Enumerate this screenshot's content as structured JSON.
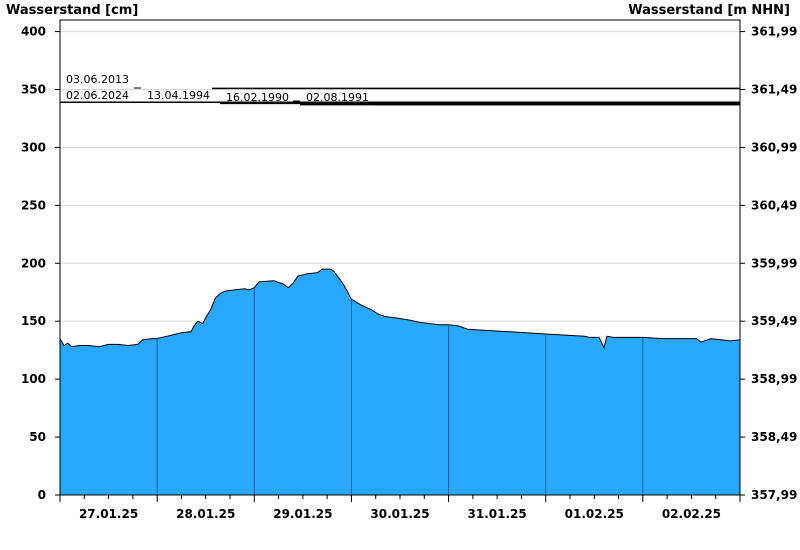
{
  "chart_data": {
    "type": "area",
    "y_left_label": "Wasserstand [cm]",
    "y_right_label": "Wasserstand [m NHN]",
    "ylim": [
      0,
      410
    ],
    "y_ticks": [
      0,
      50,
      100,
      150,
      200,
      250,
      300,
      350,
      400
    ],
    "y_right_ticks": [
      "357,99",
      "358,49",
      "358,99",
      "359,49",
      "359,99",
      "360,49",
      "360,99",
      "361,49",
      "361,99"
    ],
    "x_labels": [
      "27.01.25",
      "28.01.25",
      "29.01.25",
      "30.01.25",
      "31.01.25",
      "01.02.25",
      "02.02.25"
    ],
    "x_range_days": [
      0,
      7
    ],
    "grid": true,
    "fill_color": "#29a8ff",
    "series": [
      {
        "values": [
          [
            0.0,
            135
          ],
          [
            0.04,
            129
          ],
          [
            0.08,
            131
          ],
          [
            0.12,
            128
          ],
          [
            0.2,
            129
          ],
          [
            0.3,
            129
          ],
          [
            0.4,
            128
          ],
          [
            0.5,
            130
          ],
          [
            0.6,
            130
          ],
          [
            0.7,
            129
          ],
          [
            0.8,
            130
          ],
          [
            0.85,
            134
          ],
          [
            0.95,
            135
          ],
          [
            1.0,
            135
          ],
          [
            1.05,
            136
          ],
          [
            1.1,
            137
          ],
          [
            1.15,
            138
          ],
          [
            1.25,
            140
          ],
          [
            1.35,
            141
          ],
          [
            1.38,
            146
          ],
          [
            1.42,
            150
          ],
          [
            1.47,
            148
          ],
          [
            1.5,
            153
          ],
          [
            1.55,
            160
          ],
          [
            1.6,
            170
          ],
          [
            1.65,
            174
          ],
          [
            1.7,
            176
          ],
          [
            1.8,
            177
          ],
          [
            1.9,
            178
          ],
          [
            1.95,
            177
          ],
          [
            2.0,
            179
          ],
          [
            2.05,
            184
          ],
          [
            2.2,
            185
          ],
          [
            2.3,
            182
          ],
          [
            2.35,
            179
          ],
          [
            2.4,
            183
          ],
          [
            2.45,
            189
          ],
          [
            2.55,
            191
          ],
          [
            2.65,
            192
          ],
          [
            2.7,
            195
          ],
          [
            2.78,
            195
          ],
          [
            2.82,
            193
          ],
          [
            2.9,
            184
          ],
          [
            2.95,
            177
          ],
          [
            3.0,
            169
          ],
          [
            3.1,
            164
          ],
          [
            3.2,
            160
          ],
          [
            3.28,
            156
          ],
          [
            3.35,
            154
          ],
          [
            3.45,
            153
          ],
          [
            3.6,
            151
          ],
          [
            3.7,
            149
          ],
          [
            3.8,
            148
          ],
          [
            3.9,
            147
          ],
          [
            4.0,
            147
          ],
          [
            4.1,
            146
          ],
          [
            4.2,
            143
          ],
          [
            4.4,
            142
          ],
          [
            4.6,
            141
          ],
          [
            4.8,
            140
          ],
          [
            5.0,
            139
          ],
          [
            5.2,
            138
          ],
          [
            5.4,
            137
          ],
          [
            5.45,
            136
          ],
          [
            5.55,
            136
          ],
          [
            5.6,
            127
          ],
          [
            5.63,
            137
          ],
          [
            5.7,
            136
          ],
          [
            5.8,
            136
          ],
          [
            6.0,
            136
          ],
          [
            6.2,
            135
          ],
          [
            6.4,
            135
          ],
          [
            6.55,
            135
          ],
          [
            6.6,
            132
          ],
          [
            6.7,
            135
          ],
          [
            6.8,
            134
          ],
          [
            6.9,
            133
          ],
          [
            7.0,
            134
          ]
        ]
      }
    ],
    "annotations": [
      {
        "label": "03.06.2013",
        "value": 351
      },
      {
        "label": "02.06.2024",
        "value": 339
      },
      {
        "label": "13.04.1994",
        "value": 338
      },
      {
        "label": "16.02.1990",
        "value": 337
      },
      {
        "label": "02.08.1991",
        "value": 337
      }
    ]
  }
}
